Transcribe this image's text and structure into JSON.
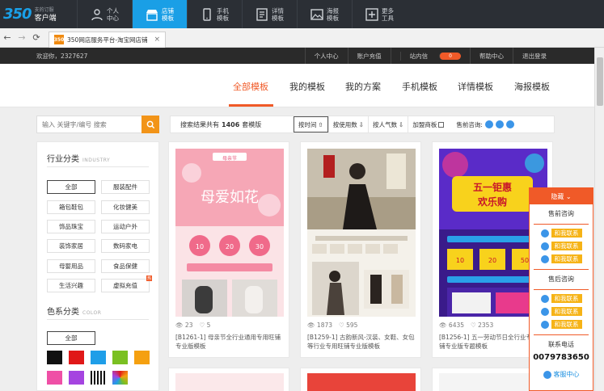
{
  "app": {
    "brand_logo": "350",
    "brand_line1": "支的订服",
    "brand_line2": "客户端",
    "tabs": [
      {
        "l1": "个人",
        "l2": "中心",
        "icon": "user-icon"
      },
      {
        "l1": "店铺",
        "l2": "模板",
        "icon": "store-icon"
      },
      {
        "l1": "手机",
        "l2": "模板",
        "icon": "phone-icon"
      },
      {
        "l1": "详情",
        "l2": "模板",
        "icon": "detail-icon"
      },
      {
        "l1": "海报",
        "l2": "模板",
        "icon": "poster-icon"
      },
      {
        "l1": "更多",
        "l2": "工具",
        "icon": "plus-icon"
      }
    ]
  },
  "browser": {
    "tab_title": "350网店服务平台-淘宝网店铺",
    "favicon_text": "350"
  },
  "site": {
    "welcome": "欢迎你，2327627",
    "links": [
      "个人中心",
      "账户充值",
      "站内信",
      "帮助中心",
      "退出登录"
    ],
    "inbox_count": "0"
  },
  "nav": {
    "items": [
      "全部模板",
      "我的模板",
      "我的方案",
      "手机模板",
      "详情模板",
      "海报模板"
    ]
  },
  "search": {
    "placeholder": "输入 关键字/编号 搜索"
  },
  "sort": {
    "results_prefix": "搜索结果共有",
    "results_count": "1406",
    "results_suffix": "套模版",
    "by_time": "按时间",
    "by_usage": "按使用数",
    "by_popularity": "按人气数",
    "new_arrivals": "加盟商板",
    "pre_sale": "售前咨询:"
  },
  "filter": {
    "industry_title": "行业分类",
    "industry_en": "INDUSTRY",
    "industry_items": [
      "全部",
      "服装配件",
      "箱包鞋包",
      "化妆健美",
      "饰品珠宝",
      "运动户外",
      "装饰家居",
      "数码家电",
      "母婴用品",
      "食品保健",
      "生活兴趣",
      "虚拟充值"
    ],
    "hot_tag": "热",
    "color_title": "色系分类",
    "color_en": "COLOR",
    "color_all": "全部",
    "colors": [
      "#111111",
      "#e01818",
      "#1f9ee8",
      "#7ac022",
      "#f5a010",
      "#ef4fa6",
      "#a544e0"
    ]
  },
  "cards": [
    {
      "views": "23",
      "likes": "5",
      "title": "[B1261-1] 母亲节全行业通用专用旺铺专业版模板",
      "poster_text": "母爱如花",
      "badge": "母亲节"
    },
    {
      "views": "1873",
      "likes": "595",
      "title": "[B1259-1] 古韵新风-汉装、女鞋、女包等行业专用旺铺专业版模板"
    },
    {
      "views": "6435",
      "likes": "2353",
      "title": "[B1256-1] 五一劳动节日全行业专用旺铺专业版专题模板",
      "poster_text1": "五一钜惠",
      "poster_text2": "欢乐购"
    }
  ],
  "float": {
    "head": "隐藏",
    "presale": "售前咨询",
    "aftersale": "售后咨询",
    "contact_btn": "和我联系",
    "phone_label": "联系电话",
    "phone": "0079783650",
    "service": "客服中心"
  }
}
